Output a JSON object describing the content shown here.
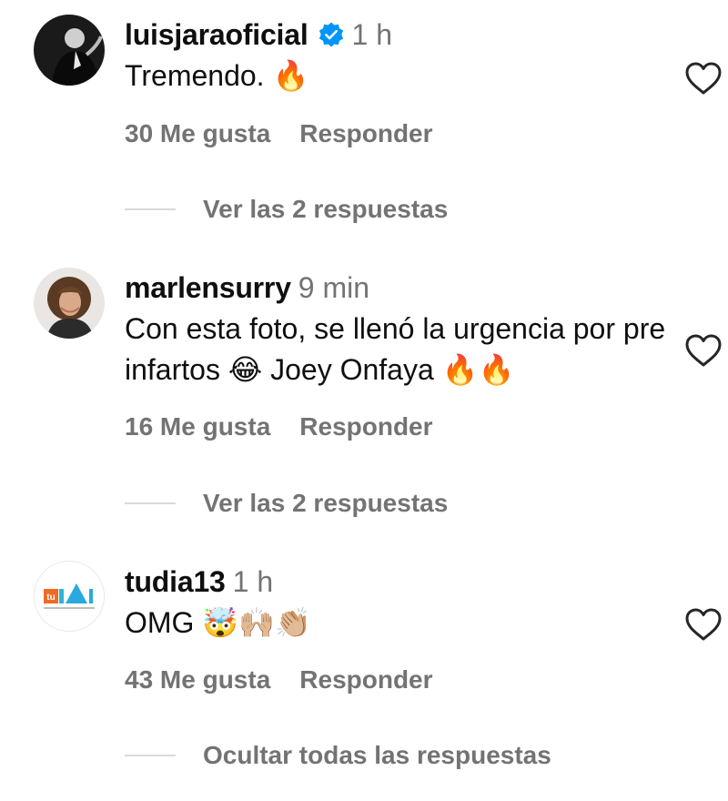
{
  "comments": [
    {
      "username": "luisjaraoficial",
      "verified_icon": "verified-badge-icon",
      "time": "1 h",
      "text": "Tremendo. 🔥",
      "likes": "30 Me gusta",
      "reply": "Responder",
      "replies_toggle": "Ver las 2 respuestas"
    },
    {
      "username": "marlensurry",
      "time": "9 min",
      "text": "Con esta foto, se llenó la urgencia por pre infartos 😂 Joey Onfaya 🔥🔥",
      "likes": "16 Me gusta",
      "reply": "Responder",
      "replies_toggle": "Ver las 2 respuestas"
    },
    {
      "username": "tudia13",
      "time": "1 h",
      "text": "OMG 🤯🙌🏼👏🏼",
      "likes": "43 Me gusta",
      "reply": "Responder",
      "replies_toggle": "Ocultar todas las respuestas",
      "avatar_logo_text": "tu DIA"
    }
  ],
  "colors": {
    "username": "#0f0f0f",
    "secondary": "#737373",
    "verified": "#0095f6",
    "divider": "#d9d9d9"
  }
}
